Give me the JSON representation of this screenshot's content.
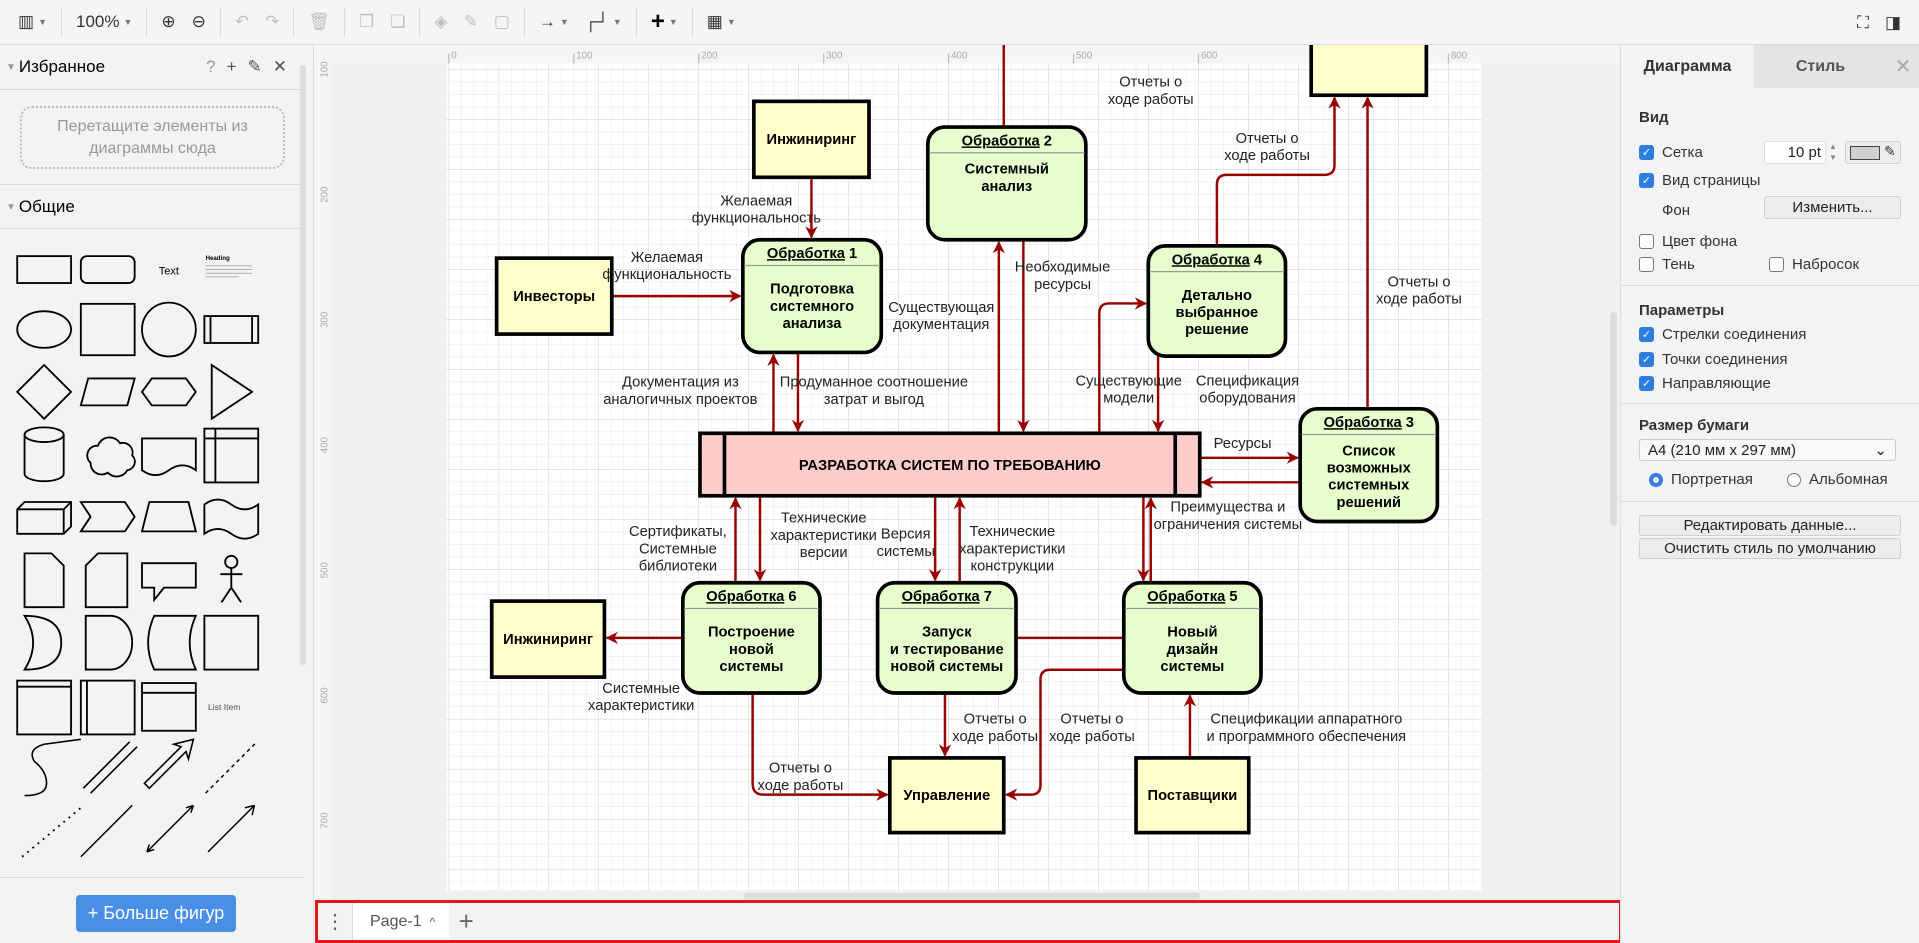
{
  "toolbar": {
    "zoom": "100%",
    "icons": [
      "layout-icon",
      "zoom-in-icon",
      "zoom-out-icon",
      "undo-icon",
      "redo-icon",
      "delete-icon",
      "to-front-icon",
      "to-back-icon",
      "fill-color-icon",
      "line-color-icon",
      "shadow-icon",
      "connection-icon",
      "waypoints-icon",
      "insert-icon",
      "table-icon",
      "fullscreen-icon",
      "format-panel-icon"
    ]
  },
  "sidebar": {
    "favorites_title": "Избранное",
    "favorites_tools": [
      "?",
      "+"
    ],
    "dropzone_text": "Перетащите элементы из диаграммы сюда",
    "general_title": "Общие",
    "shape_text": "Text",
    "shape_heading": "Heading",
    "shape_list_item": "List Item",
    "more_shapes": "+ Больше фигур"
  },
  "diagram": {
    "colors": {
      "edge": "#990000",
      "process": "#e6ffcc",
      "external": "#ffffcc",
      "main": "#ffcccc"
    },
    "ruler_x": [
      "0",
      "100",
      "200",
      "300",
      "400",
      "500",
      "600",
      "700",
      "800"
    ],
    "ruler_y": [
      "100",
      "200",
      "300",
      "400",
      "500",
      "600",
      "700"
    ],
    "main_process": "РАЗРАБОТКА СИСТЕМ ПО ТРЕБОВАНИЮ",
    "externals": [
      "Инжиниринг",
      "Инвесторы",
      "",
      "Инжиниринг",
      "Управление",
      "Поставщики"
    ],
    "processes": [
      {
        "header": "Обработка",
        "num": " 1",
        "lines": [
          "Подготовка",
          "системного",
          "анализа"
        ]
      },
      {
        "header": "Обработка",
        "num": " 2",
        "lines": [
          "Системный",
          "анализ"
        ]
      },
      {
        "header": "Обработка",
        "num": " 4",
        "lines": [
          "Детально",
          "выбранное",
          "решение"
        ]
      },
      {
        "header": "Обработка",
        "num": " 3",
        "lines": [
          "Список",
          "возможных",
          "системных",
          "решений"
        ]
      },
      {
        "header": "Обработка",
        "num": " 6",
        "lines": [
          "Построение",
          "новой",
          "системы"
        ]
      },
      {
        "header": "Обработка",
        "num": " 7",
        "lines": [
          "Запуск",
          "и тестирование",
          "новой системы"
        ]
      },
      {
        "header": "Обработка",
        "num": " 5",
        "lines": [
          "Новый",
          "дизайн",
          "системы"
        ]
      }
    ],
    "labels": [
      [
        "Желаемая",
        "функциональность"
      ],
      [
        "Желаемая",
        "функциональность"
      ],
      [
        "Документация из",
        "аналогичных проектов"
      ],
      [
        "Продуманное соотношение",
        "затрат и выгод"
      ],
      [
        "Существующая",
        "документация"
      ],
      [
        "Необходимые",
        "ресурсы"
      ],
      [
        "Отчеты о",
        "ходе работы"
      ],
      [
        "Отчеты о",
        "ходе работы"
      ],
      [
        "Отчеты о",
        "ходе работы"
      ],
      [
        "Существующие",
        "модели"
      ],
      [
        "Спецификация",
        "оборудования"
      ],
      [
        "Ресурсы"
      ],
      [
        "Преимущества и",
        "ограничения системы"
      ],
      [
        "Сертификаты,",
        "Системные",
        "библиотеки"
      ],
      [
        "Технические",
        "характеристики",
        "версии"
      ],
      [
        "Версия",
        "системы"
      ],
      [
        "Технические",
        "характеристики",
        "конструкции"
      ],
      [
        "Системные",
        "характеристики"
      ],
      [
        "Отчеты о",
        "ходе работы"
      ],
      [
        "Отчеты о",
        "ходе работы"
      ],
      [
        "Отчеты о",
        "ходе работы"
      ],
      [
        "Спецификации аппаратного",
        "и программного обеспечения"
      ]
    ]
  },
  "pages": {
    "tabs": [
      {
        "label": "Page-1"
      }
    ],
    "add": "+"
  },
  "panel": {
    "tabs": [
      "Диаграмма",
      "Стиль"
    ],
    "view_title": "Вид",
    "grid": {
      "label": "Сетка",
      "checked": true,
      "size": "10 pt",
      "color": "#d0d0d0"
    },
    "page_view": {
      "label": "Вид страницы",
      "checked": true
    },
    "background": {
      "label": "Фон",
      "button": "Изменить..."
    },
    "bg_color": {
      "label": "Цвет фона",
      "checked": false
    },
    "shadow": {
      "label": "Тень",
      "checked": false
    },
    "sketch": {
      "label": "Набросок",
      "checked": false
    },
    "options_title": "Параметры",
    "options": [
      {
        "label": "Стрелки соединения",
        "checked": true
      },
      {
        "label": "Точки соединения",
        "checked": true
      },
      {
        "label": "Направляющие",
        "checked": true
      }
    ],
    "paper_title": "Размер бумаги",
    "paper_size": "A4 (210 мм x 297 мм)",
    "orientation": {
      "portrait": "Портретная",
      "landscape": "Альбомная",
      "selected": "portrait"
    },
    "edit_data": "Редактировать данные...",
    "clear_style": "Очистить стиль по умолчанию"
  }
}
